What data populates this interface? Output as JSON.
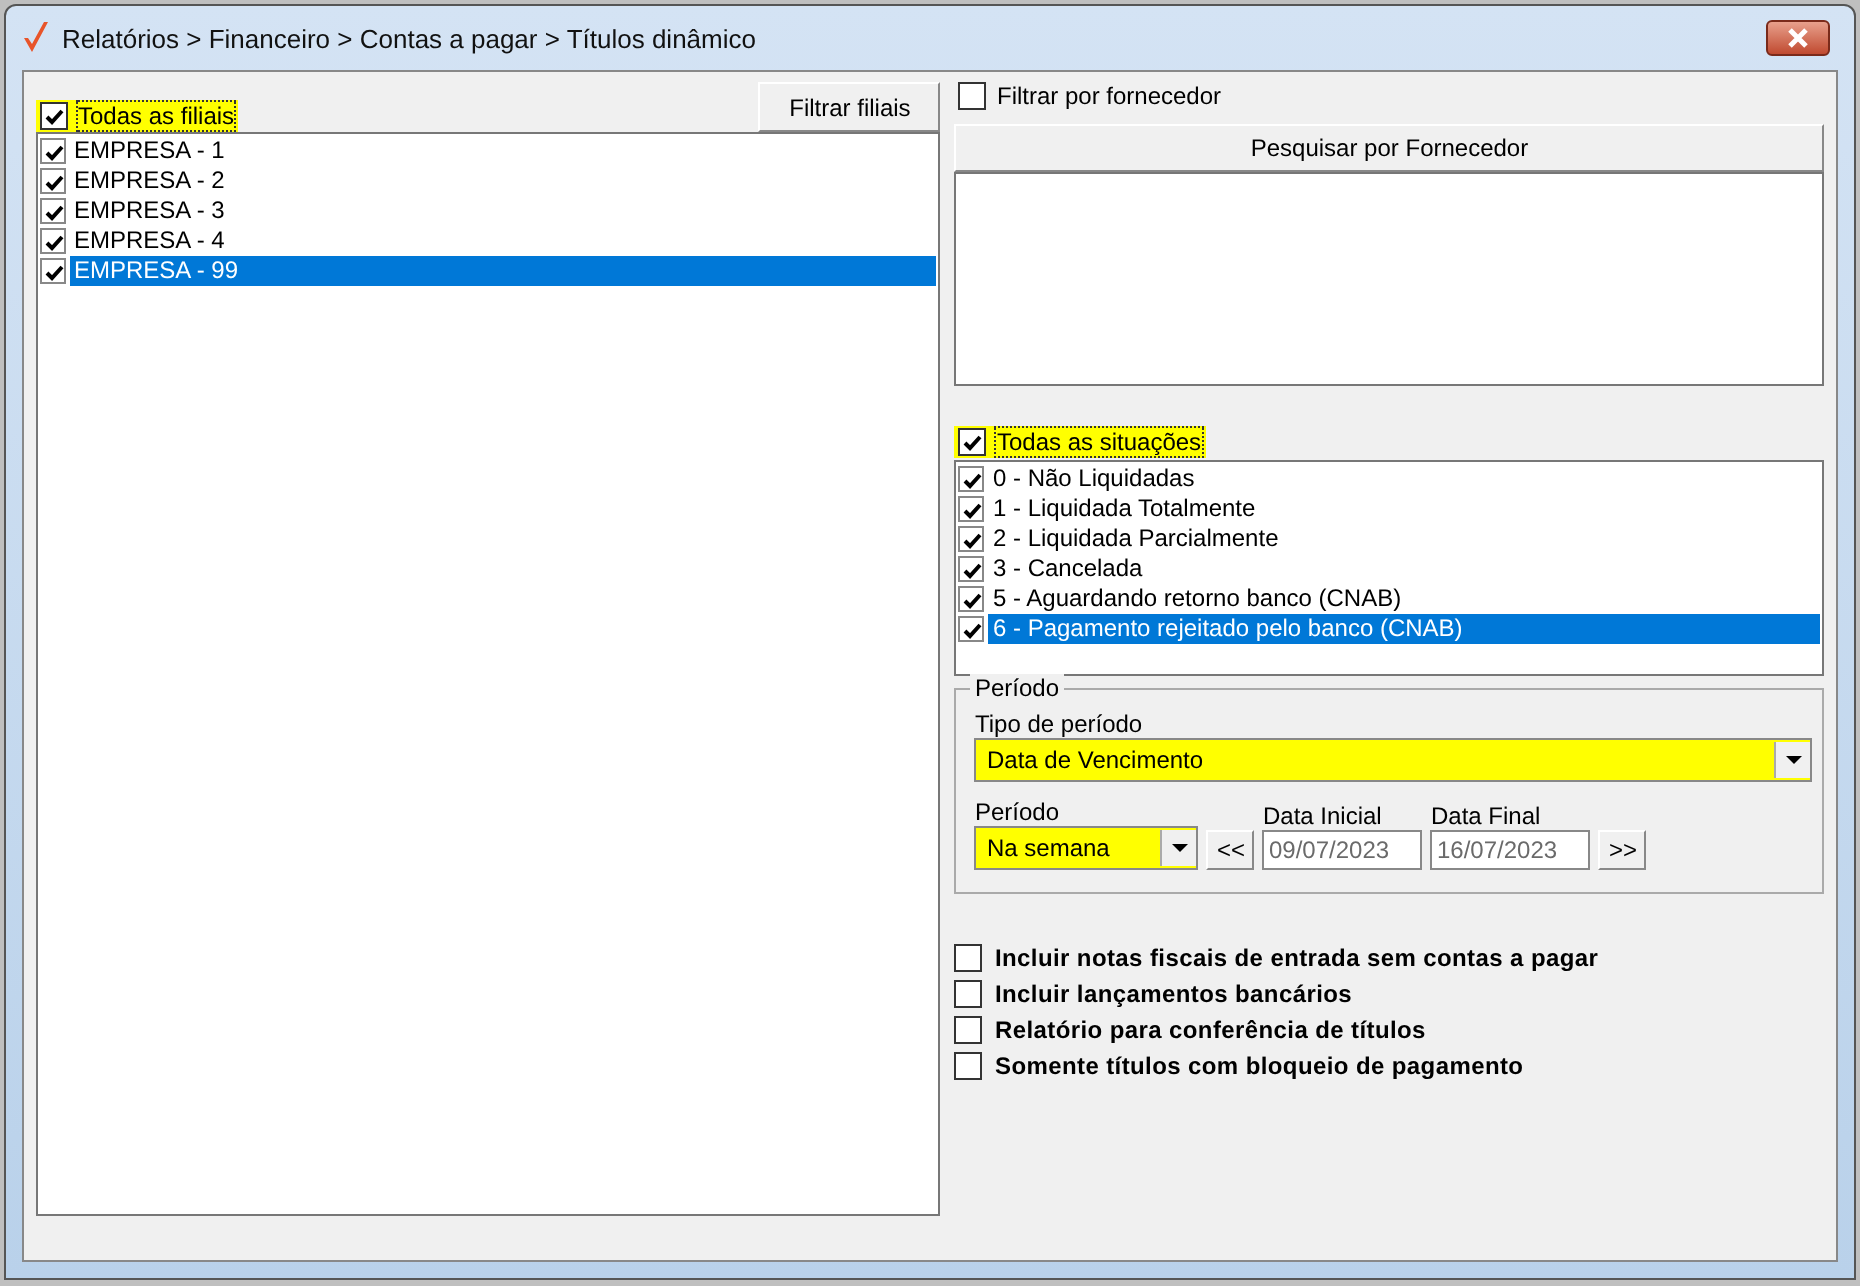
{
  "window": {
    "title": "Relatórios > Financeiro > Contas a pagar > Títulos dinâmico"
  },
  "branches": {
    "all": {
      "label": "Todas as filiais",
      "checked": true,
      "highlighted": true
    },
    "filter_button": "Filtrar filiais",
    "items": [
      {
        "label": "EMPRESA - 1",
        "checked": true,
        "selected": false
      },
      {
        "label": "EMPRESA - 2",
        "checked": true,
        "selected": false
      },
      {
        "label": "EMPRESA - 3",
        "checked": true,
        "selected": false
      },
      {
        "label": "EMPRESA - 4",
        "checked": true,
        "selected": false
      },
      {
        "label": "EMPRESA - 99",
        "checked": true,
        "selected": true
      }
    ]
  },
  "supplier": {
    "filter": {
      "label": "Filtrar por fornecedor",
      "checked": false
    },
    "search_button": "Pesquisar por Fornecedor"
  },
  "statuses": {
    "all": {
      "label": "Todas as situações",
      "checked": true,
      "highlighted": true
    },
    "items": [
      {
        "label": "0 - Não Liquidadas",
        "checked": true,
        "selected": false
      },
      {
        "label": "1 - Liquidada Totalmente",
        "checked": true,
        "selected": false
      },
      {
        "label": "2 - Liquidada Parcialmente",
        "checked": true,
        "selected": false
      },
      {
        "label": "3 - Cancelada",
        "checked": true,
        "selected": false
      },
      {
        "label": "5 - Aguardando retorno banco (CNAB)",
        "checked": true,
        "selected": false
      },
      {
        "label": "6 - Pagamento rejeitado pelo banco (CNAB)",
        "checked": true,
        "selected": true
      }
    ]
  },
  "period": {
    "title": "Período",
    "type_label": "Tipo de período",
    "type": {
      "value": "Data de Vencimento",
      "highlighted": true
    },
    "period_label": "Período",
    "period": {
      "value": "Na semana",
      "highlighted": true
    },
    "prev_button": "<<",
    "next_button": ">>",
    "start": {
      "label": "Data Inicial",
      "value": "09/07/2023",
      "disabled": true
    },
    "end": {
      "label": "Data Final",
      "value": "16/07/2023",
      "disabled": true
    }
  },
  "options": [
    {
      "label": "Incluir notas fiscais de entrada sem contas a pagar",
      "checked": false
    },
    {
      "label": "Incluir lançamentos bancários",
      "checked": false
    },
    {
      "label": "Relatório para conferência de títulos",
      "checked": false
    },
    {
      "label": "Somente títulos com bloqueio de pagamento",
      "checked": false
    }
  ]
}
